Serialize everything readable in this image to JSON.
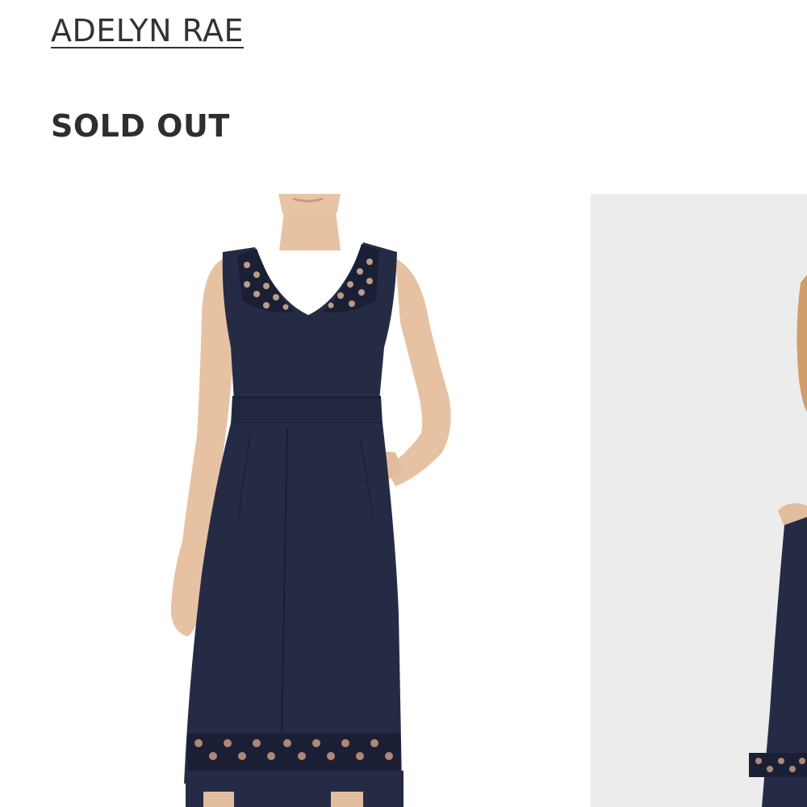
{
  "brand": {
    "name": "ADELYN RAE"
  },
  "status": {
    "label": "SOLD OUT"
  },
  "gallery": {
    "images": [
      {
        "name": "product-photo-front"
      },
      {
        "name": "product-photo-side"
      }
    ]
  },
  "colors": {
    "text": "#2e2e2e",
    "garment": "#262b45",
    "skin": "#e9c6a8",
    "photo_background": "#ececec"
  }
}
